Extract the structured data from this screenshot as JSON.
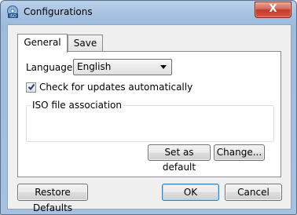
{
  "window": {
    "title": "Configurations",
    "close_symbol": "X",
    "app_icon": "iso-app-icon",
    "app_icon_text": "ISO"
  },
  "tabs": [
    {
      "label": "General",
      "active": true
    },
    {
      "label": "Save",
      "active": false
    }
  ],
  "general": {
    "language_label": "Language:",
    "language_value": "English",
    "auto_update_label": "Check for updates automatically",
    "auto_update_checked": true,
    "iso_group_title": "ISO file association",
    "set_default_label": "Set as default",
    "change_label": "Change..."
  },
  "footer": {
    "restore_label": "Restore Defaults",
    "ok_label": "OK",
    "cancel_label": "Cancel"
  }
}
